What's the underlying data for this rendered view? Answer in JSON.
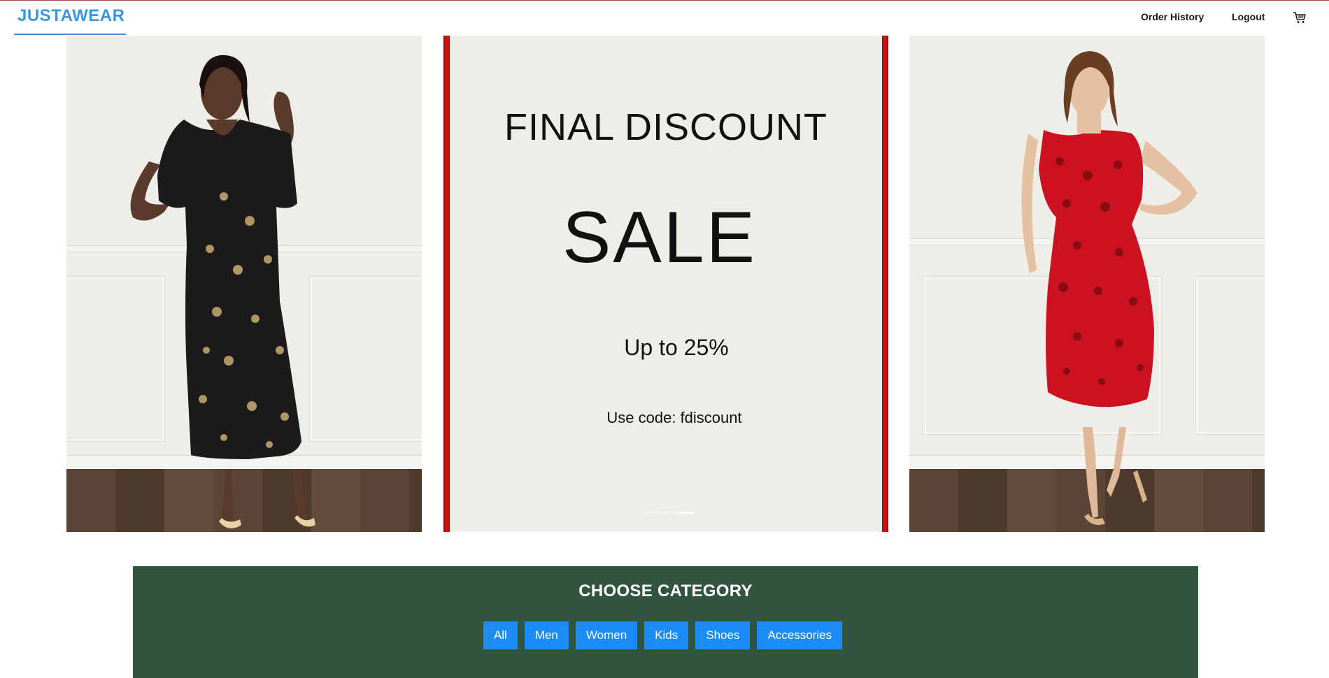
{
  "brand": {
    "name": "JUSTAWEAR"
  },
  "nav": {
    "order_history": "Order History",
    "logout": "Logout",
    "cart_icon": "shopping-cart-icon"
  },
  "hero": {
    "promo": {
      "title": "FINAL DISCOUNT",
      "sale": "SALE",
      "discount": "Up to 25%",
      "code": "Use code: fdiscount"
    },
    "carousel": {
      "slides": 3,
      "active_slide": 3
    }
  },
  "categories": {
    "title": "CHOOSE CATEGORY",
    "buttons": [
      "All",
      "Men",
      "Women",
      "Kids",
      "Shoes",
      "Accessories"
    ]
  },
  "colors": {
    "brand": "#3a96e0",
    "category_bg": "#325540",
    "button": "#1b8bf5",
    "promo_border": "#c81414"
  }
}
